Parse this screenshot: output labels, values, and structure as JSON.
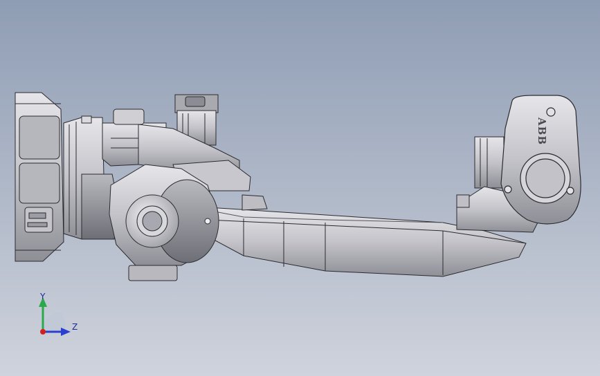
{
  "viewport": {
    "background_top": "#8f9db4",
    "background_bottom": "#cfd3dc",
    "model_fill": "#c9c9cf",
    "model_stroke": "#2a2a2e"
  },
  "logo": {
    "text": "ABB"
  },
  "triad": {
    "y_label": "Y",
    "z_label": "Z",
    "y_color": "#2aa84a",
    "z_color": "#2a3fd0",
    "origin_color": "#d02020"
  }
}
